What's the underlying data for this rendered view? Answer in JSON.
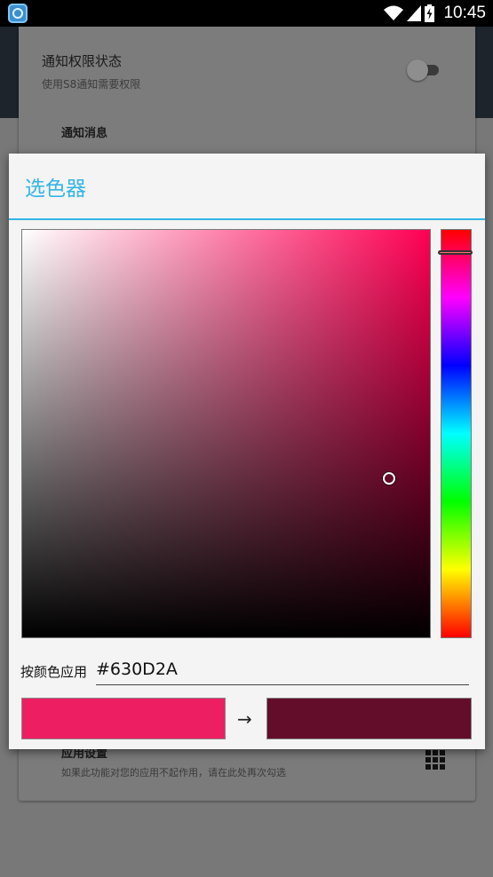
{
  "status_bar": {
    "time": "10:45",
    "icons": [
      "wifi-icon",
      "signal-icon",
      "battery-icon"
    ]
  },
  "background": {
    "title": "通知权限状态",
    "subtitle": "使用S8通知需要权限",
    "section_label": "通知消息",
    "item_title": "应用设置",
    "item_desc": "如果此功能对您的应用不起作用，请在此处再次勾选"
  },
  "dialog": {
    "title": "选色器",
    "hex_label": "按颜色应用",
    "hex_value": "#630D2A",
    "arrow": "→",
    "old_color": "#ED1E62",
    "new_color": "#630D2A",
    "hue_color": "#FF0055",
    "picker": {
      "saturation": 0.9,
      "value": 0.39,
      "hue_fraction": 0.057
    }
  },
  "colors": {
    "accent": "#33B5E5",
    "header": "#1D242C"
  }
}
